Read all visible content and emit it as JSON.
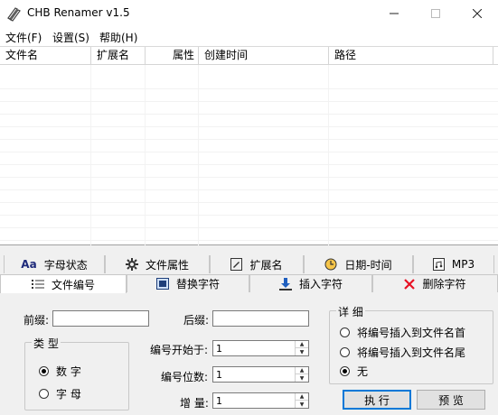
{
  "window": {
    "title": "CHB Renamer v1.5"
  },
  "menu": {
    "file": "文件(F)",
    "settings": "设置(S)",
    "help": "帮助(H)"
  },
  "list": {
    "columns": [
      "文件名",
      "扩展名",
      "属性",
      "创建时间",
      "路径"
    ]
  },
  "tabs_top": [
    "字母状态",
    "文件属性",
    "扩展名",
    "日期-时间",
    "MP3"
  ],
  "tabs_bottom": [
    "文件编号",
    "替换字符",
    "插入字符",
    "删除字符"
  ],
  "active_tab": "文件编号",
  "tab_prefix_text": "Aa",
  "panel": {
    "prefix_label": "前缀:",
    "prefix_value": "",
    "suffix_label": "后缀:",
    "suffix_value": "",
    "type_group": "类 型",
    "type_number": "数 字",
    "type_letter": "字 母",
    "start_label": "编号开始于:",
    "start_value": "1",
    "digits_label": "编号位数:",
    "digits_value": "1",
    "increment_label": "增 量:",
    "increment_value": "1",
    "detail_group": "详 细",
    "detail_head": "将编号插入到文件名首",
    "detail_tail": "将编号插入到文件名尾",
    "detail_none": "无",
    "execute_button": "执 行",
    "preview_button": "预 览"
  },
  "colors": {
    "tab_delete_icon": "#e81123",
    "tab_insert_icon": "#1f5fbf",
    "aa_text": "#1e2a7a"
  }
}
